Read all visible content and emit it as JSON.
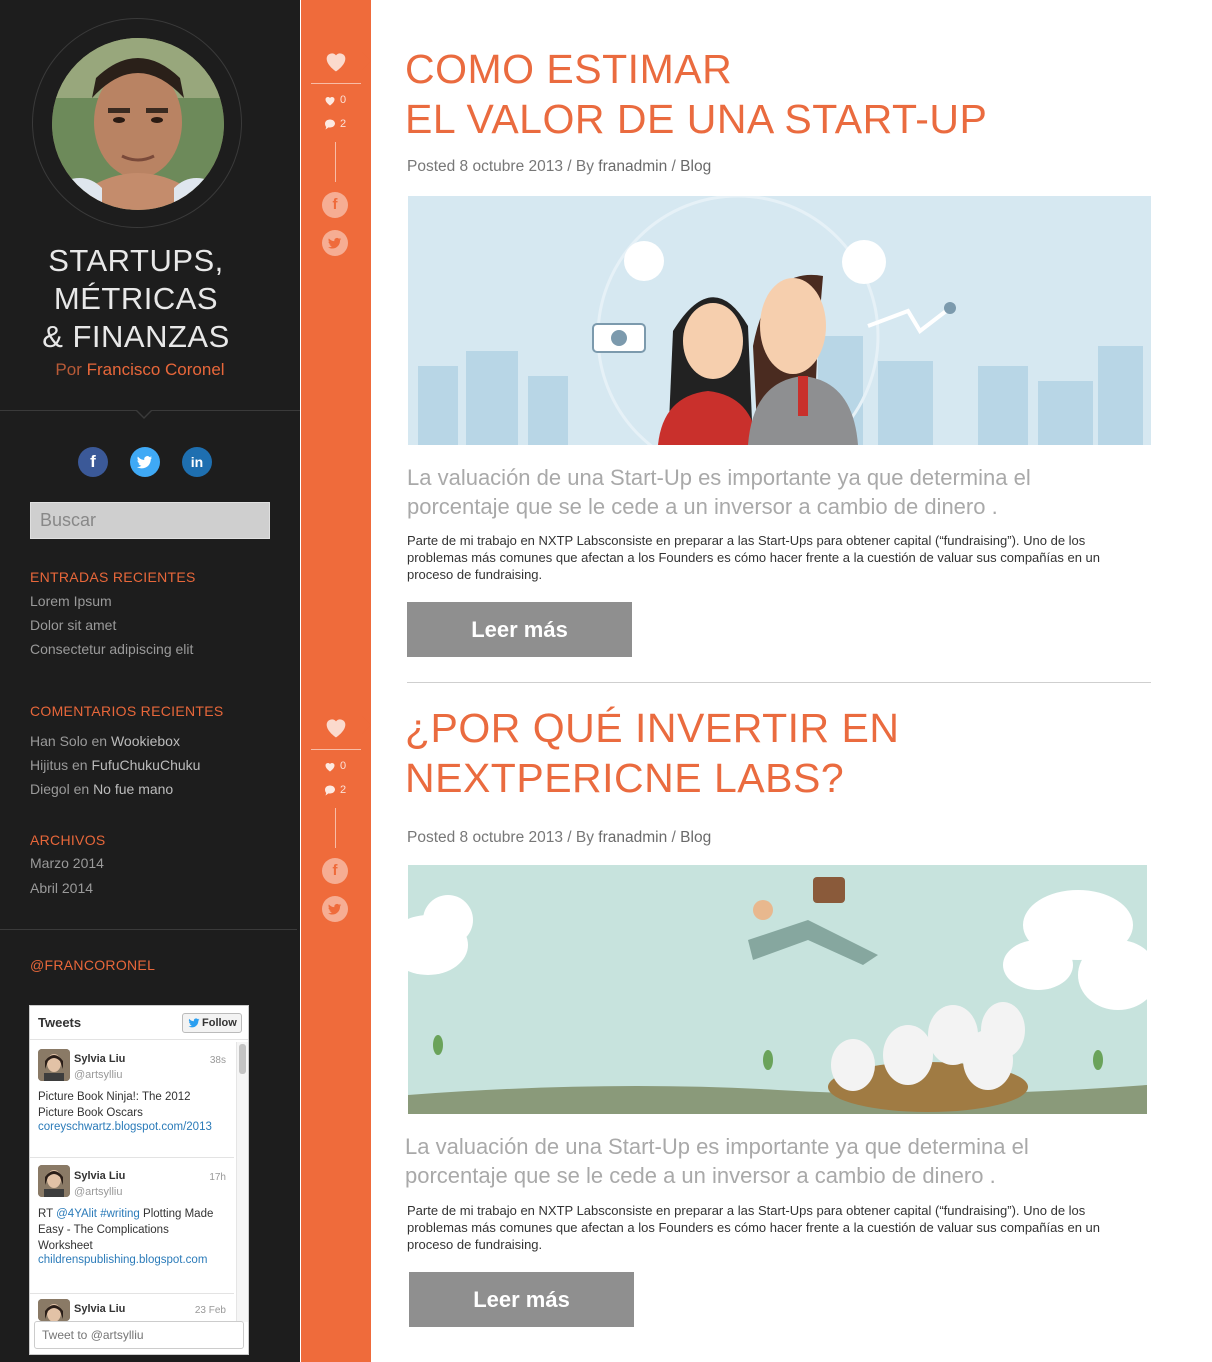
{
  "sidebar": {
    "title_line1": "STARTUPS,",
    "title_line2": "MÉTRICAS",
    "title_line3": "& FINANZAS",
    "byline_prefix": "Por",
    "byline_author": "Francisco Coronel",
    "social": [
      {
        "icon": "facebook-icon",
        "glyph": "f",
        "color": "#3b5998"
      },
      {
        "icon": "twitter-icon",
        "glyph": "t",
        "color": "#3fa9f5"
      },
      {
        "icon": "linkedin-icon",
        "glyph": "in",
        "color": "#1e6fb0"
      }
    ],
    "search_placeholder": "Buscar",
    "recent_posts": {
      "title": "ENTRADAS RECIENTES",
      "items": [
        "Lorem Ipsum",
        "Dolor sit amet",
        "Consectetur adipiscing elit"
      ]
    },
    "recent_comments": {
      "title": "COMENTARIOS RECIENTES",
      "connector": "en",
      "items": [
        {
          "author": "Han Solo",
          "post": "Wookiebox"
        },
        {
          "author": "Hijitus",
          "post": "FufuChukuChuku"
        },
        {
          "author": "Diegol",
          "post": "No fue mano"
        }
      ]
    },
    "archives": {
      "title": "ARCHIVOS",
      "items": [
        "Marzo 2014",
        "Abril 2014"
      ]
    },
    "twitter_handle_title": "@FRANCORONEL"
  },
  "twitter_widget": {
    "title": "Tweets",
    "follow_label": "Follow",
    "compose_placeholder": "Tweet to @artsylliu",
    "tweets": [
      {
        "name": "Sylvia Liu",
        "handle": "@artsylliu",
        "time": "38s",
        "text": "Picture Book Ninja!: The 2012 Picture Book Oscars",
        "url": "coreyschwartz.blogspot.com/2013"
      },
      {
        "name": "Sylvia Liu",
        "handle": "@artsylliu",
        "time": "17h",
        "rt": "RT",
        "mention": "@4YAlit",
        "hashtag": "#writing",
        "text": "Plotting Made Easy - The Complications Worksheet",
        "url": "childrenspublishing.blogspot.com"
      },
      {
        "name": "Sylvia Liu",
        "time": "23 Feb"
      }
    ]
  },
  "colors": {
    "accent": "#ef6b3b",
    "sidebar_bg": "#1d1d1d",
    "button": "#8f8f8f"
  },
  "posts": [
    {
      "title_line1": "COMO ESTIMAR",
      "title_line2": "EL VALOR DE UNA START-UP",
      "likes": "0",
      "comments": "2",
      "meta_prefix": "Posted 8 octubre 2013 / By",
      "author": "franadmin",
      "sep": "/",
      "category": "Blog",
      "lead": "La valuación de una Start-Up es importante ya que determina el porcentaje que se le cede a un inversor a cambio de dinero .",
      "body": "Parte de mi trabajo en NXTP Labsconsiste en preparar a las Start-Ups  para obtener capital (“fundraising”). Uno de los problemas más comunes que afectan a los Founders es cómo hacer frente a la cuestión de valuar  sus compañías en un proceso de fundraising.",
      "button": "Leer más"
    },
    {
      "title_line1": "¿POR QUÉ INVERTIR EN",
      "title_line2": "NEXTPERICNE LABS?",
      "likes": "0",
      "comments": "2",
      "meta_prefix": "Posted 8 octubre 2013 / By",
      "author": "franadmin",
      "sep": "/",
      "category": "Blog",
      "lead": "La valuación de una Start-Up es importante ya que determina el porcentaje que se le cede a un inversor a cambio de dinero .",
      "body": "Parte de mi trabajo en NXTP Labsconsiste en preparar a las Start-Ups  para obtener capital (“fundraising”). Uno de los problemas más comunes que afectan a los Founders es cómo hacer frente a la cuestión de valuar  sus compañías en un proceso de fundraising.",
      "button": "Leer más"
    }
  ]
}
